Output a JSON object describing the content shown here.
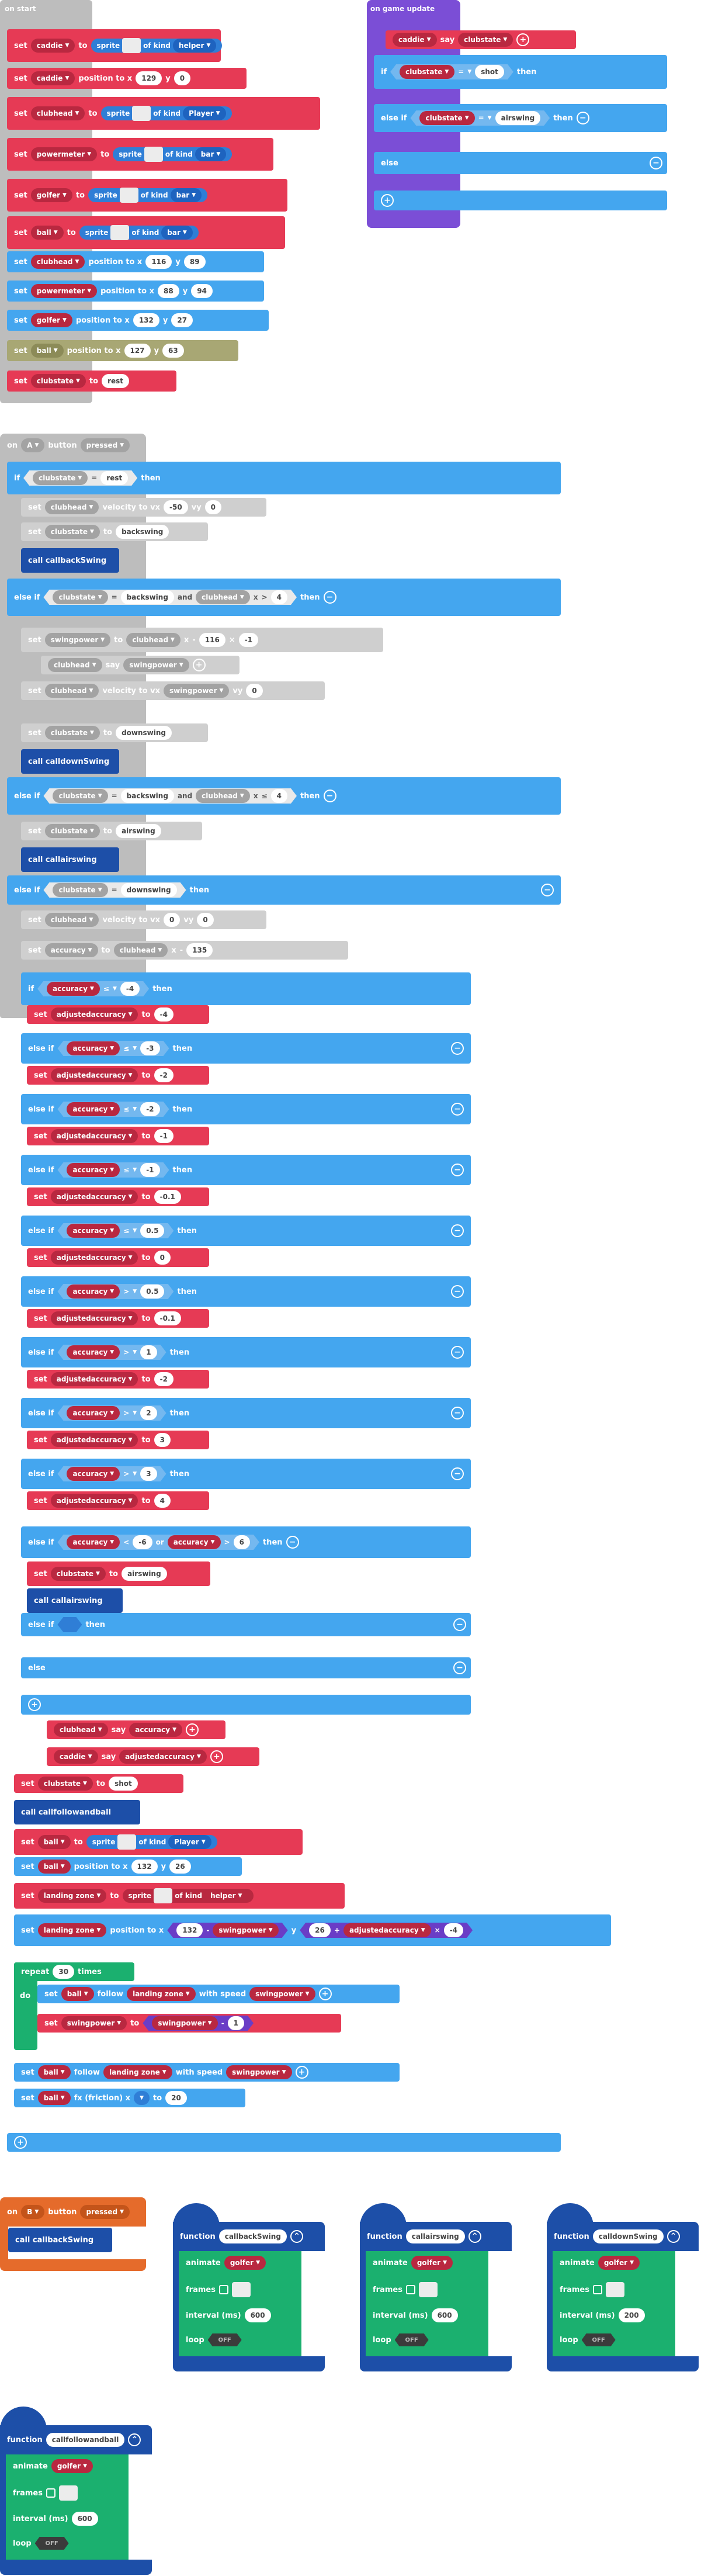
{
  "on_start": {
    "title": "on start",
    "set": "set",
    "to": "to",
    "position_to_x": "position to x",
    "y": "y",
    "sprite": "sprite",
    "of_kind": "of kind",
    "rows": [
      {
        "var": "caddie",
        "kind": "helper"
      },
      {
        "var": "caddie",
        "x": "129",
        "yv": "0"
      },
      {
        "var": "clubhead",
        "kind": "Player"
      },
      {
        "var": "powermeter",
        "kind": "bar"
      },
      {
        "var": "golfer",
        "kind": "bar"
      },
      {
        "var": "ball",
        "kind": "bar"
      },
      {
        "var": "clubhead",
        "x": "116",
        "yv": "89"
      },
      {
        "var": "powermeter",
        "x": "88",
        "yv": "94"
      },
      {
        "var": "golfer",
        "x": "132",
        "yv": "27"
      },
      {
        "var": "ball",
        "x": "127",
        "yv": "63"
      },
      {
        "var": "clubstate",
        "value": "rest"
      }
    ]
  },
  "on_game_update": {
    "title": "on game update",
    "caddie": "caddie",
    "say": "say",
    "clubstate": "clubstate",
    "if": "if",
    "eq": "=",
    "shot": "shot",
    "then": "then",
    "else_if": "else if",
    "airswing": "airswing",
    "else": "else"
  },
  "on_a": {
    "on": "on",
    "button": "A",
    "button_word": "button",
    "pressed": "pressed",
    "if": "if",
    "clubstate": "clubstate",
    "eq": "=",
    "rest": "rest",
    "then": "then",
    "set": "set",
    "clubhead": "clubhead",
    "velocity_to_vx": "velocity to vx",
    "vy": "vy",
    "v1": "-50",
    "v2": "0",
    "to": "to",
    "backswing": "backswing",
    "call_backswing": "call callbackSwing",
    "else_if": "else if",
    "and": "and",
    "x": "x",
    "gt": ">",
    "num4": "4",
    "swingpower": "swingpower",
    "minus": "-",
    "times": "×",
    "n116": "116",
    "neg1": "-1",
    "say": "say",
    "downswing": "downswing",
    "call_downswing": "call calldownSwing",
    "le": "≤",
    "airswing": "airswing",
    "call_airswing": "call callairswing",
    "vx0": "0",
    "vy0": "0",
    "accuracy": "accuracy",
    "n135": "135",
    "adjustedaccuracy": "adjustedaccuracy",
    "ladder": [
      {
        "kw": "if",
        "op": "≤",
        "cmp": "-4",
        "val": "-4"
      },
      {
        "kw": "else if",
        "op": "≤",
        "cmp": "-3",
        "val": "-2"
      },
      {
        "kw": "else if",
        "op": "≤",
        "cmp": "-2",
        "val": "-1"
      },
      {
        "kw": "else if",
        "op": "≤",
        "cmp": "-1",
        "val": "-0.1"
      },
      {
        "kw": "else if",
        "op": "≤",
        "cmp": "0.5",
        "val": "0"
      },
      {
        "kw": "else if",
        "op": ">",
        "cmp": "0.5",
        "val": "-0.1"
      },
      {
        "kw": "else if",
        "op": ">",
        "cmp": "1",
        "val": "-2"
      },
      {
        "kw": "else if",
        "op": ">",
        "cmp": "2",
        "val": "3"
      },
      {
        "kw": "else if",
        "op": ">",
        "cmp": "3",
        "val": "4"
      }
    ],
    "lt": "<",
    "or": "or",
    "neg6": "-6",
    "pos6": "6",
    "else": "else",
    "caddie": "caddie",
    "shot": "shot",
    "call_follow": "call callfollowandball",
    "ball": "ball",
    "sprite": "sprite",
    "of_kind": "of kind",
    "player": "Player",
    "position_to_x": "position to x",
    "y": "y",
    "bx": "132",
    "by": "26",
    "landing_zone": "landing zone",
    "helper": "helper",
    "lz_x": "132",
    "lz_y": "26",
    "plus": "+",
    "lz_mul": "-4",
    "repeat": "repeat",
    "times_n": "30",
    "times_word": "times",
    "do": "do",
    "follow": "follow",
    "with_speed": "with speed",
    "minus1": "1",
    "fx": "fx (friction) x",
    "fx_v": "20"
  },
  "on_b": {
    "on": "on",
    "button": "B",
    "button_word": "button",
    "pressed": "pressed",
    "call": "call callbackSwing"
  },
  "functions": [
    {
      "name": "callbackSwing",
      "interval": "600"
    },
    {
      "name": "callairswing",
      "interval": "600"
    },
    {
      "name": "calldownSwing",
      "interval": "200"
    },
    {
      "name": "callfollowandball",
      "interval": "600"
    }
  ],
  "fn_common": {
    "function": "function",
    "animate": "animate",
    "golfer": "golfer",
    "frames": "frames",
    "interval": "interval (ms)",
    "loop": "loop",
    "off": "OFF"
  }
}
